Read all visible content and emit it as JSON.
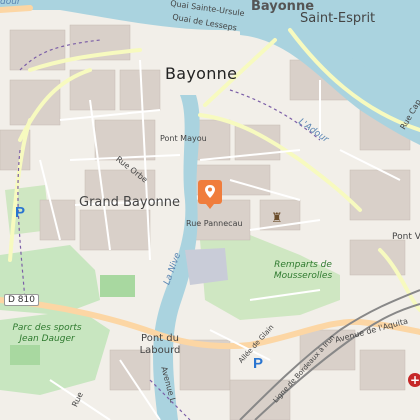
{
  "labels": {
    "bayonne_top": "Bayonne",
    "saint_esprit": "Saint-Esprit",
    "bayonne_main": "Bayonne",
    "grand_bayonne": "Grand Bayonne",
    "pont_mayou": "Pont Mayou",
    "rue_orbe": "Rue Orbe",
    "rue_pannecau": "Rue Pannecau",
    "adour": "L'Adour",
    "nive": "La Nive",
    "remparts": "Remparts de Mousserolles",
    "parc_sports": "Parc des sports Jean Dauger",
    "pont_labourd": "Pont du Labourd",
    "d810": "D 810",
    "quai_lesseps": "Quai de Lesseps",
    "quai_ursule": "Quai Sainte-Ursule",
    "avenue_aquitaine": "Avenue de l'Aquita",
    "allee_glain": "Allée de Glain",
    "ligne_bordeaux": "Ligne de Bordeaux à Irun",
    "rue_cap": "Rue Cap",
    "pont_va": "Pont V",
    "avenue_left": "Avenue L",
    "rue_partial_left": "Rue",
    "top_left_partial": "dour"
  },
  "icons": {
    "marker": "map-pin-icon",
    "parking": "parking-icon",
    "castle": "castle-icon",
    "hospital": "hospital-icon"
  },
  "colors": {
    "land": "#f2efe9",
    "water": "#aad3df",
    "park": "#c8e6c0",
    "building": "#d9d0c9",
    "road_main": "#fcd6a4",
    "road_yellow": "#f7fabf",
    "marker": "#f07d3c",
    "boundary": "#7b5ea7"
  }
}
